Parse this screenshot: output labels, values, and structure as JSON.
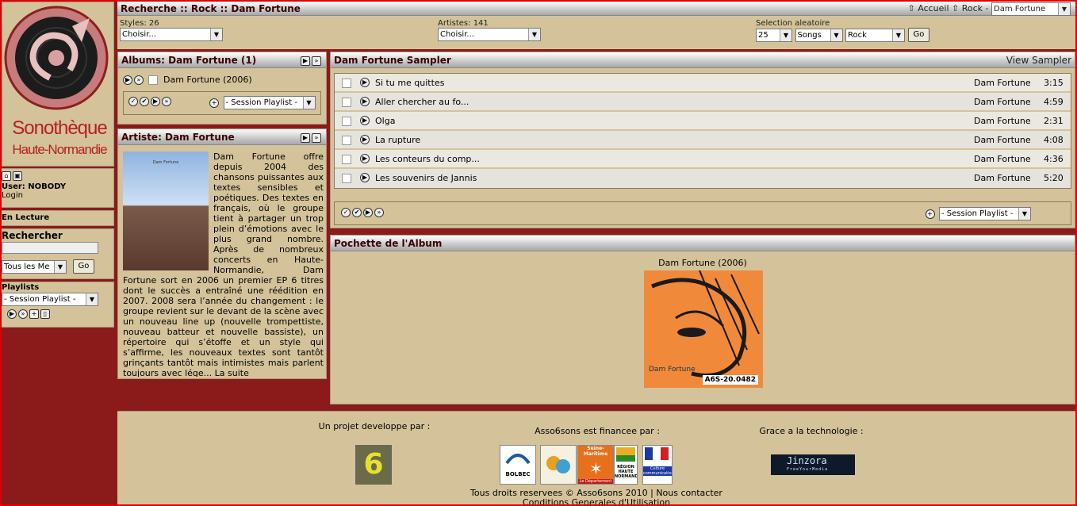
{
  "logo": {
    "line1": "Sonothèque",
    "line2": "Haute-Normandie"
  },
  "sidebar": {
    "user_label": "User: NOBODY",
    "login_link": "Login",
    "now_playing_title": "En Lecture",
    "search_title": "Rechercher",
    "search_value": "",
    "search_scope": "Tous les Me",
    "search_go": "Go",
    "playlists_title": "Playlists",
    "playlist_select": "- Session Playlist -"
  },
  "topbar": {
    "breadcrumb": "Recherche :: Rock :: Dam Fortune",
    "home_link": "Accueil",
    "genre_link": "Rock -",
    "artist_select": "Dam Fortune",
    "styles_label": "Styles: 26",
    "styles_select": "Choisir...",
    "artists_label": "Artistes: 141",
    "artists_select": "Choisir...",
    "random_label": "Selection aleatoire",
    "random_count": "25",
    "random_type": "Songs",
    "random_genre": "Rock",
    "random_go": "Go"
  },
  "albums_panel": {
    "title": "Albums: Dam Fortune (1)",
    "album_item": "Dam Fortune (2006)",
    "playlist_select": "- Session Playlist -"
  },
  "artist_panel": {
    "title": "Artiste: Dam Fortune",
    "photo_caption": "Dam Fortune",
    "bio": "Dam Fortune offre depuis 2004 des chansons puissantes aux textes sensibles et poétiques. Des textes en français, où le groupe tient à partager un trop plein d’émotions avec le plus grand nombre. Après de nombreux concerts en Haute-Normandie, Dam Fortune sort en 2006 un premier EP 6 titres dont le succès a entraîné une réédition en 2007. 2008 sera l’année du changement : le groupe revient sur le devant de la scène avec un nouveau line up (nouvelle trompettiste, nouveau batteur et nouvelle bassiste), un répertoire qui s’étoffe et un style qui s’affirme, les nouveaux textes sont tantôt grinçants tantôt mais intimistes mais parlent toujours avec lége...",
    "more_link": "La suite"
  },
  "sampler_panel": {
    "title": "Dam Fortune Sampler",
    "view_link": "View Sampler",
    "tracks": [
      {
        "title": "Si tu me quittes",
        "artist": "Dam Fortune",
        "duration": "3:15"
      },
      {
        "title": "Aller chercher au fo...",
        "artist": "Dam Fortune",
        "duration": "4:59"
      },
      {
        "title": "Olga",
        "artist": "Dam Fortune",
        "duration": "2:31"
      },
      {
        "title": "La rupture",
        "artist": "Dam Fortune",
        "duration": "4:08"
      },
      {
        "title": "Les conteurs du comp...",
        "artist": "Dam Fortune",
        "duration": "4:36"
      },
      {
        "title": "Les souvenirs de Jannis",
        "artist": "Dam Fortune",
        "duration": "5:20"
      }
    ],
    "playlist_select": "- Session Playlist -"
  },
  "cover_panel": {
    "title": "Pochette de l'Album",
    "album_caption": "Dam Fortune (2006)",
    "cover_band": "Dam Fortune",
    "cover_code": "A6S-20.0482"
  },
  "footer": {
    "project_label": "Un projet developpe par :",
    "funded_label": "Asso6sons est financee par :",
    "tech_label": "Grace a la technologie :",
    "sponsor_bolbec": "BOLBEC",
    "sponsor_seine": "Seine-Maritime",
    "sponsor_dept": "Le Département",
    "sponsor_region": "RÉGION HAUTE NORMANDIE",
    "sponsor_culture": "Culture communication",
    "jinzora": "Jinzora",
    "jinzora_tag": "FreeYourMedia",
    "copyright": "Tous droits reservees © Asso6sons 2010 | Nous contacter",
    "cgu": "Conditions Generales d'Utilisation"
  },
  "colors": {
    "background": "#8b1a1a",
    "panel": "#d4c39a",
    "frame": "#e00000",
    "accent": "#b52020"
  }
}
